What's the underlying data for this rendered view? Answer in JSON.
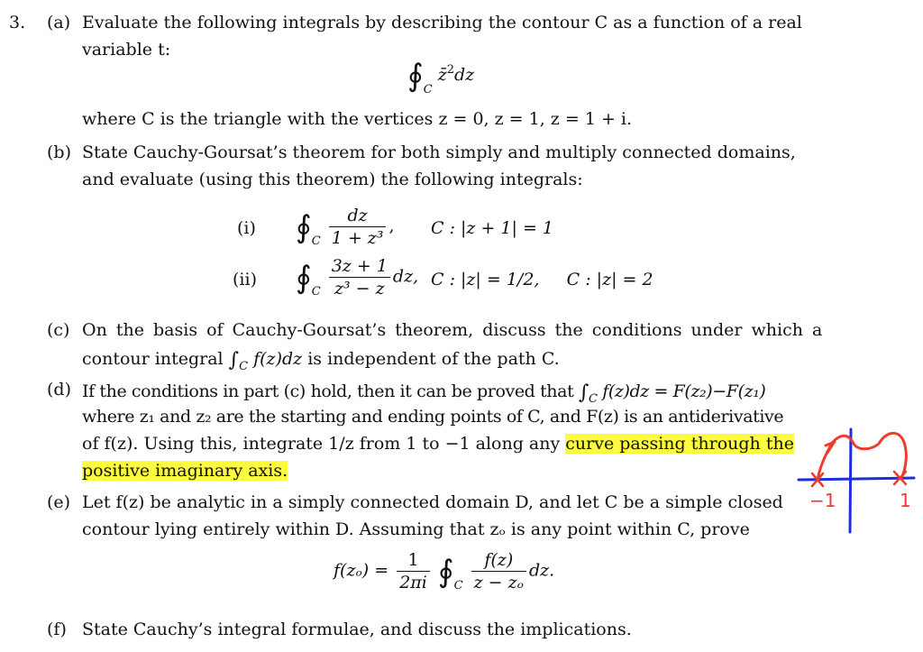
{
  "problem": {
    "number": "3.",
    "parts": {
      "a": {
        "label": "(a)",
        "line1": "Evaluate the following integrals by describing the contour C as a function of a real",
        "line2": "variable t:",
        "integral": {
          "symbol": "∮",
          "subscript": "C",
          "integrand": "z̄",
          "power": "2",
          "diff": "dz"
        },
        "line3": "where C is the triangle with the vertices z = 0, z = 1, z = 1 + i."
      },
      "b": {
        "label": "(b)",
        "line1": "State Cauchy-Goursat’s theorem for both simply and multiply connected domains,",
        "line2": "and evaluate (using this theorem) the following integrals:",
        "items": [
          {
            "label": "(i)",
            "numerator": "dz",
            "denominator": "1 + z³",
            "suffix": ",",
            "contour": "C : |z + 1| = 1"
          },
          {
            "label": "(ii)",
            "numerator": "3z + 1",
            "denominator": "z³ − z",
            "suffix": "dz,",
            "contour": "C : |z| = 1/2,     C : |z| = 2"
          }
        ]
      },
      "c": {
        "label": "(c)",
        "line1": "On the basis of Cauchy-Goursat’s theorem, discuss the conditions under which a",
        "line2_pre": "contour integral",
        "line2_int": "∫",
        "line2_sub": "C",
        "line2_expr": "f(z)dz",
        "line2_post": "is independent of the path C."
      },
      "d": {
        "label": "(d)",
        "line1_pre": "If the conditions in part (c) hold, then it can be proved that",
        "line1_int": "∫",
        "line1_sub": "C",
        "line1_expr": "f(z)dz = F(z₂)−F(z₁)",
        "line2": "where z₁ and z₂ are the starting and ending points of C, and F(z) is an antiderivative",
        "line3_pre": "of f(z). Using this, integrate 1/z from 1 to −1 along any",
        "line3_highlight": "curve passing through the",
        "line4_highlight": "positive imaginary axis."
      },
      "e": {
        "label": "(e)",
        "line1": "Let f(z) be analytic in a simply connected domain D, and let C be a simple closed",
        "line2": "contour lying entirely within D. Assuming that zₒ is any point within C, prove",
        "formula": {
          "lhs": "f(zₒ) =",
          "coef_num": "1",
          "coef_den": "2πi",
          "symbol": "∮",
          "subscript": "C",
          "num": "f(z)",
          "den": "z − zₒ",
          "suffix": "dz."
        }
      },
      "f": {
        "label": "(f)",
        "line1": "State Cauchy’s integral formulae, and discuss the implications."
      }
    }
  },
  "annotation": {
    "left_label": "−1",
    "right_label": "1",
    "axis_color": "#1a2fe0",
    "curve_color": "#ee3b2b",
    "highlight_color": "#fdfb3e"
  }
}
